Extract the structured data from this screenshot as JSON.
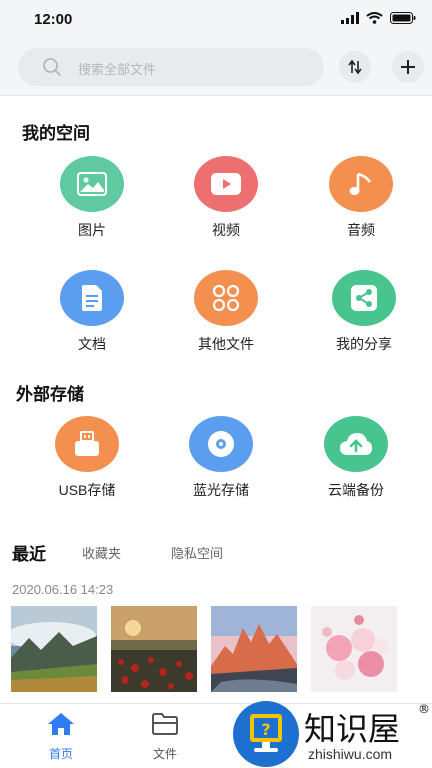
{
  "status_bar": {
    "time": "12:00"
  },
  "search": {
    "placeholder": "搜索全部文件"
  },
  "my_space": {
    "title": "我的空间",
    "items": [
      {
        "label": "图片",
        "icon": "image-icon",
        "color": "#5fc9a0"
      },
      {
        "label": "视频",
        "icon": "video-play-icon",
        "color": "#ee6f6f"
      },
      {
        "label": "音频",
        "icon": "music-note-icon",
        "color": "#f39050"
      },
      {
        "label": "文档",
        "icon": "document-icon",
        "color": "#5b9ef0"
      },
      {
        "label": "其他文件",
        "icon": "grid-icon",
        "color": "#f39050"
      },
      {
        "label": "我的分享",
        "icon": "share-icon",
        "color": "#48c48e"
      }
    ]
  },
  "external_storage": {
    "title": "外部存储",
    "items": [
      {
        "label": "USB存储",
        "icon": "usb-icon",
        "color": "#f39050"
      },
      {
        "label": "蓝光存储",
        "icon": "disc-icon",
        "color": "#5b9ef0"
      },
      {
        "label": "云端备份",
        "icon": "cloud-upload-icon",
        "color": "#48c48e"
      }
    ]
  },
  "recent": {
    "tabs": [
      "最近",
      "收藏夹",
      "隐私空间"
    ],
    "timestamp": "2020.06.16 14:23",
    "thumbnails": [
      "mountain-cloud-photo",
      "poppy-field-photo",
      "patagonia-peaks-photo",
      "pink-roses-photo"
    ]
  },
  "bottom_nav": {
    "items": [
      {
        "label": "首页",
        "icon": "home-icon",
        "active": true
      },
      {
        "label": "文件",
        "icon": "folder-icon",
        "active": false
      }
    ],
    "active_color": "#2f7cf6"
  },
  "watermark": {
    "logo_text": "知识屋",
    "registered": "®",
    "url": "zhishiwu.com"
  }
}
